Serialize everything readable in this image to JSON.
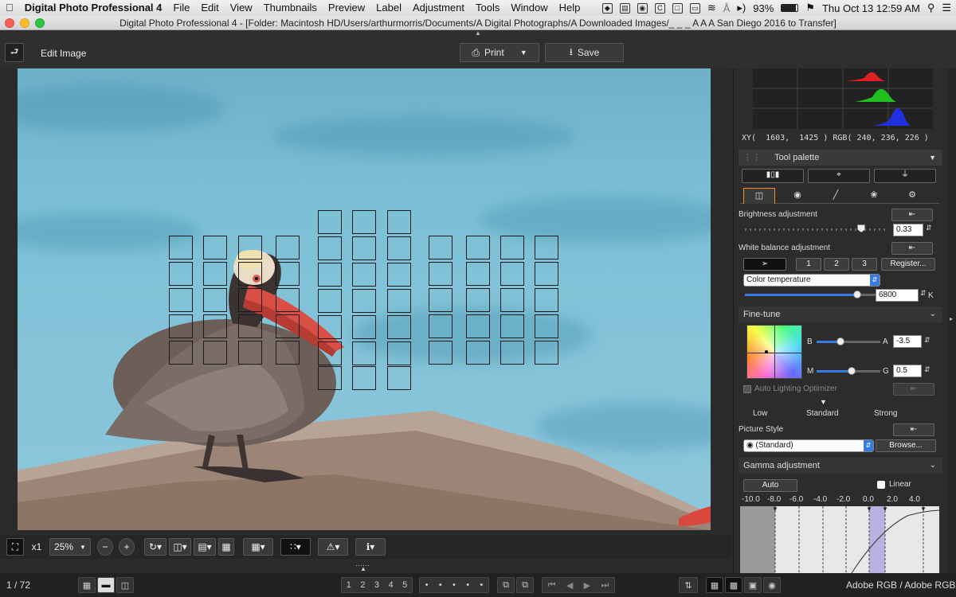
{
  "menubar": {
    "app": "Digital Photo Professional 4",
    "items": [
      "File",
      "Edit",
      "View",
      "Thumbnails",
      "Preview",
      "Label",
      "Adjustment",
      "Tools",
      "Window",
      "Help"
    ],
    "battery": "93%",
    "clock": "Thu Oct 13  12:59 AM"
  },
  "window": {
    "title": "Digital Photo Professional 4 - [Folder: Macintosh HD/Users/arthurmorris/Documents/A Digital Photographs/A Downloaded Images/_ _ _ A A A San Diego 2016 to Transfer]"
  },
  "toolbar": {
    "mode_label": "Edit Image",
    "print_label": "Print",
    "save_label": "Save"
  },
  "histogram": {
    "readout": "XY(  1603,  1425 ) RGB( 240, 236, 226 )"
  },
  "tool_palette": {
    "title": "Tool palette",
    "brightness": {
      "label": "Brightness adjustment",
      "value": "0.33",
      "level": 0.83
    },
    "white_balance": {
      "label": "White balance adjustment",
      "presets": [
        "1",
        "2",
        "3"
      ],
      "register_label": "Register...",
      "mode": "Color temperature",
      "temperature": "6800",
      "unit": "K",
      "level": 0.82
    },
    "fine_tune": {
      "label": "Fine-tune",
      "b_label": "B",
      "a_label": "A",
      "a_value": "-3.5",
      "ba_level": 0.38,
      "m_label": "M",
      "g_label": "G",
      "g_value": "0.5",
      "mg_level": 0.55
    },
    "alo": {
      "label": "Auto Lighting Optimizer",
      "levels": [
        "Low",
        "Standard",
        "Strong"
      ]
    },
    "picture_style": {
      "label": "Picture Style",
      "value": "(Standard)",
      "browse_label": "Browse..."
    },
    "gamma": {
      "label": "Gamma adjustment",
      "auto_label": "Auto",
      "linear_label": "Linear",
      "scale": [
        "-10.0",
        "-8.0",
        "-6.0",
        "-4.0",
        "-2.0",
        "0.0",
        "2.0",
        "4.0"
      ]
    }
  },
  "bottom_toolbar": {
    "zoom_x1": "x1",
    "zoom_level": "25%"
  },
  "status": {
    "counter": "1 / 72",
    "ratings": [
      "1",
      "2",
      "3",
      "4",
      "5"
    ],
    "color_space": "Adobe RGB / Adobe RGB"
  }
}
